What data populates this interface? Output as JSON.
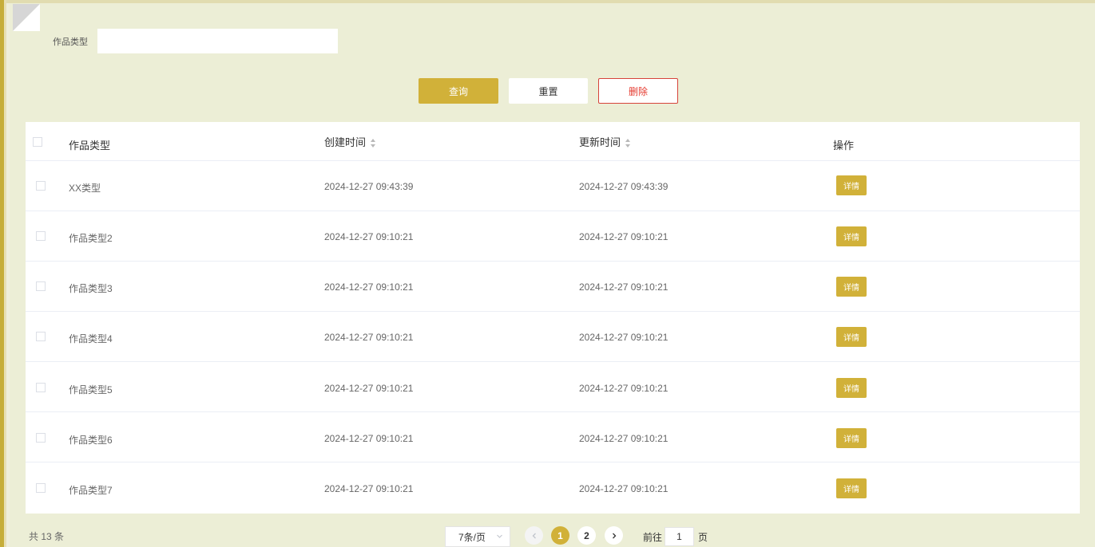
{
  "search": {
    "label": "作品类型",
    "value": "",
    "placeholder": ""
  },
  "buttons": {
    "query": "查询",
    "reset": "重置",
    "delete": "删除"
  },
  "table": {
    "headers": {
      "type": "作品类型",
      "created": "创建时间",
      "updated": "更新时间",
      "action": "操作"
    },
    "rows": [
      {
        "type": "XX类型",
        "created": "2024-12-27 09:43:39",
        "updated": "2024-12-27 09:43:39",
        "action": "详情"
      },
      {
        "type": "作品类型2",
        "created": "2024-12-27 09:10:21",
        "updated": "2024-12-27 09:10:21",
        "action": "详情"
      },
      {
        "type": "作品类型3",
        "created": "2024-12-27 09:10:21",
        "updated": "2024-12-27 09:10:21",
        "action": "详情"
      },
      {
        "type": "作品类型4",
        "created": "2024-12-27 09:10:21",
        "updated": "2024-12-27 09:10:21",
        "action": "详情"
      },
      {
        "type": "作品类型5",
        "created": "2024-12-27 09:10:21",
        "updated": "2024-12-27 09:10:21",
        "action": "详情"
      },
      {
        "type": "作品类型6",
        "created": "2024-12-27 09:10:21",
        "updated": "2024-12-27 09:10:21",
        "action": "详情"
      },
      {
        "type": "作品类型7",
        "created": "2024-12-27 09:10:21",
        "updated": "2024-12-27 09:10:21",
        "action": "详情"
      }
    ]
  },
  "pagination": {
    "total": "共 13 条",
    "page_size": "7条/页",
    "pages": [
      "1",
      "2"
    ],
    "current_page": "1",
    "goto_prefix": "前往",
    "goto_value": "1",
    "goto_suffix": "页"
  },
  "colors": {
    "accent": "#d1b139",
    "danger": "#e53a2f",
    "background": "#eceed6"
  },
  "icons": {
    "prev": "chevron-left-icon",
    "next": "chevron-right-icon",
    "sort": "sort-caret-icon",
    "dropdown": "chevron-down-icon"
  }
}
